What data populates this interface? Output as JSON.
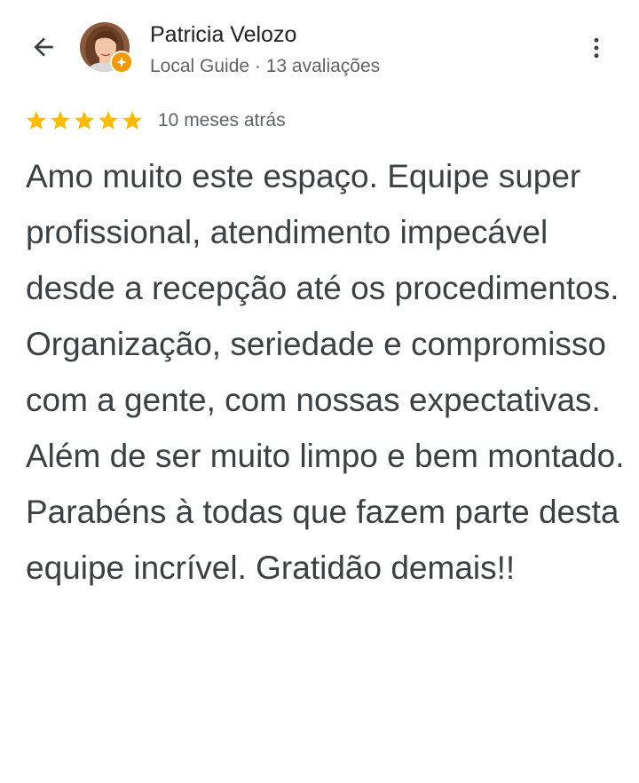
{
  "header": {
    "back_icon": "arrow-back-icon",
    "author_name": "Patricia Velozo",
    "author_meta": "Local Guide · 13 avaliações",
    "avatar_icon": "profile-photo",
    "badge_icon": "local-guide-star-icon",
    "badge_color": "#f29900",
    "more_icon": "more-vertical-icon"
  },
  "review": {
    "rating": 5,
    "rating_max": 5,
    "star_color": "#fbbc04",
    "date": "10 meses atrás",
    "text": "Amo muito este espaço. Equipe super profissional, atendimento impecável desde a recepção até os procedimentos. Organização, seriedade e compromisso com a gente, com nossas expectativas. Além de ser muito limpo e bem montado. Parabéns à todas que fazem parte desta equipe incrível. Gratidão demais!!"
  }
}
